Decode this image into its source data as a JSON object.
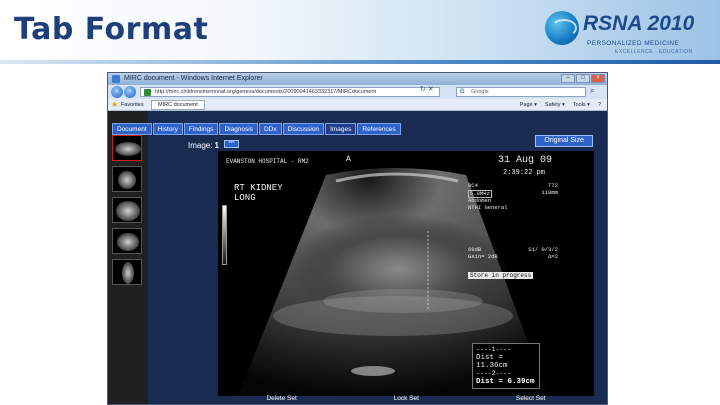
{
  "slide": {
    "title": "Tab Format",
    "logo": {
      "brand": "RSNA 2010",
      "subtitle": "PERSONALIZED MEDICINE",
      "tagline": "EXCELLENCE · EDUCATION"
    }
  },
  "browser": {
    "window_title": "MIRC document - Windows Internet Explorer",
    "address": "http://mirc.childrensmemorial.org/geneva/documents/20090041463332317/MIRCdocument",
    "search_placeholder": "Google",
    "favorites_label": "Favorites",
    "tab_label": "MIRC document",
    "toolbar": [
      "Page ▾",
      "Safety ▾",
      "Tools ▾",
      "?"
    ]
  },
  "page": {
    "nav_tabs": [
      "Document",
      "History",
      "Findings",
      "Diagnosis",
      "DDx",
      "Discussion",
      "Images",
      "References"
    ],
    "active_tab": "Images",
    "image_label": "Image:",
    "image_number": "1",
    "image_tag": "***",
    "original_size_button": "Original Size",
    "bottom_controls": [
      "Delete Set",
      "Lock Set",
      "Select Set"
    ]
  },
  "ultrasound": {
    "hospital": "EVANSTON HOSPITAL - RM2",
    "date": "31 Aug 09",
    "time": "2:39:22 pm",
    "probe_marker": "A",
    "label_line1": "RT KIDNEY",
    "label_line2": "LONG",
    "params": [
      [
        "8C4",
        "T72"
      ],
      [
        "5.0MHz",
        "110mm"
      ],
      [
        "Abdomen",
        ""
      ],
      [
        "NTHI General",
        ""
      ]
    ],
    "gain": [
      [
        "68dB",
        "S1/ 0/3/2"
      ],
      [
        "Gain= 2dB",
        "Δ=2"
      ]
    ],
    "store_status": "Store in progress",
    "measurement": {
      "line1": "----1----",
      "dist1": "Dist = 11.36cm",
      "line2": "----2----",
      "dist2": "Dist = 6.39cm"
    }
  }
}
